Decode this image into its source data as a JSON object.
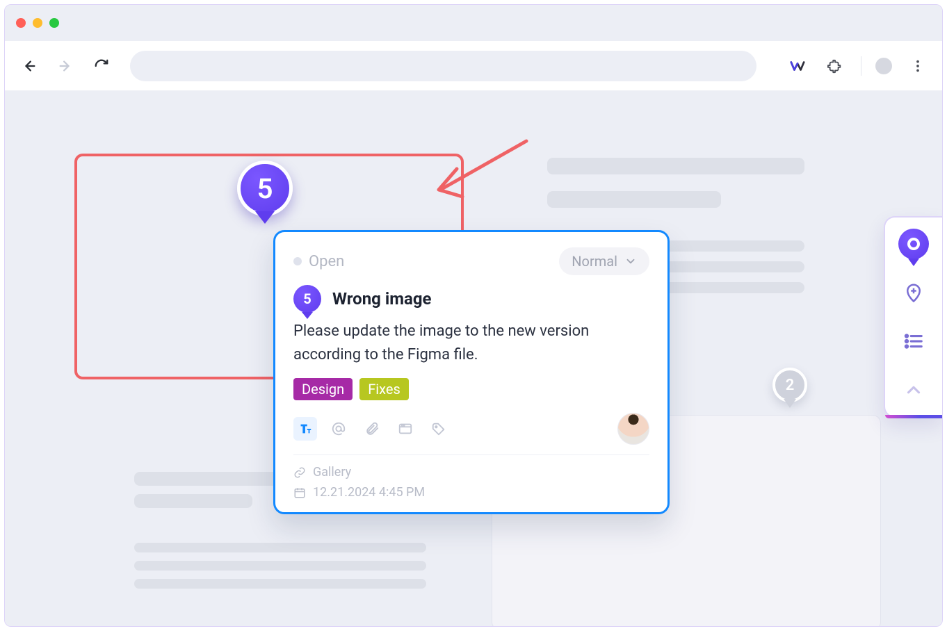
{
  "browser": {
    "logo_label": "W"
  },
  "annotation_pin": {
    "number": "5"
  },
  "marker_secondary": {
    "number": "2"
  },
  "card": {
    "status_label": "Open",
    "priority_label": "Normal",
    "pin_number": "5",
    "title": "Wrong image",
    "body": "Please update the image to the new version according to the Figma file.",
    "tags": [
      {
        "label": "Design",
        "class": "design"
      },
      {
        "label": "Fixes",
        "class": "fixes"
      }
    ],
    "link_label": "Gallery",
    "timestamp": "12.21.2024 4:45 PM"
  }
}
